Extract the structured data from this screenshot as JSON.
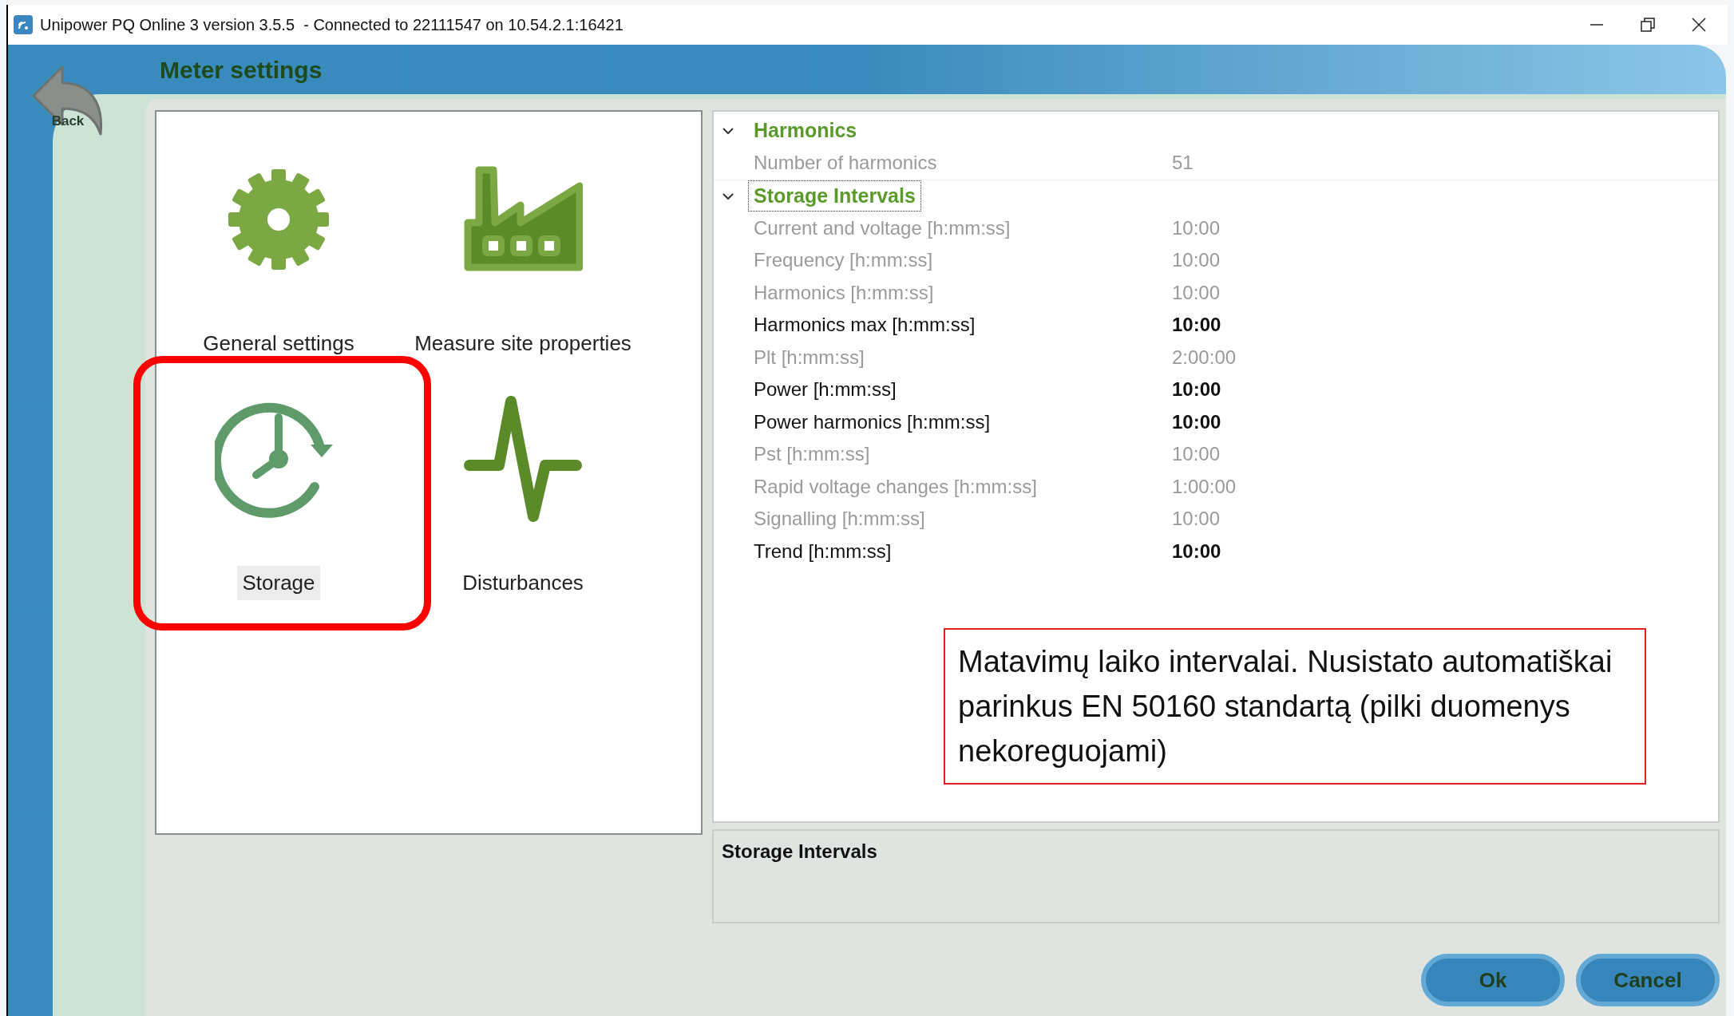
{
  "window": {
    "title": "Unipower PQ Online 3 version 3.5.5  - Connected to 22111547 on 10.54.2.1:16421"
  },
  "back_button": {
    "label": "Back"
  },
  "header": {
    "title": "Meter settings"
  },
  "categories": [
    {
      "label": "General settings",
      "kind": "gear",
      "selected": false,
      "highlighted": false
    },
    {
      "label": "Measure site properties",
      "kind": "factory",
      "selected": false,
      "highlighted": false
    },
    {
      "label": "Storage",
      "kind": "clock",
      "selected": true,
      "highlighted": true
    },
    {
      "label": "Disturbances",
      "kind": "pulse",
      "selected": false,
      "highlighted": false
    }
  ],
  "property_grid": {
    "groups": [
      {
        "title": "Harmonics",
        "expanded": true,
        "focused": false,
        "properties": [
          {
            "name": "Number of harmonics",
            "value": "51",
            "readonly": true
          }
        ]
      },
      {
        "title": "Storage Intervals",
        "expanded": true,
        "focused": true,
        "properties": [
          {
            "name": "Current and voltage [h:mm:ss]",
            "value": "10:00",
            "readonly": true
          },
          {
            "name": "Frequency [h:mm:ss]",
            "value": "10:00",
            "readonly": true
          },
          {
            "name": "Harmonics [h:mm:ss]",
            "value": "10:00",
            "readonly": true
          },
          {
            "name": "Harmonics max [h:mm:ss]",
            "value": "10:00",
            "readonly": false
          },
          {
            "name": "Plt [h:mm:ss]",
            "value": "2:00:00",
            "readonly": true
          },
          {
            "name": "Power [h:mm:ss]",
            "value": "10:00",
            "readonly": false
          },
          {
            "name": "Power harmonics [h:mm:ss]",
            "value": "10:00",
            "readonly": false
          },
          {
            "name": "Pst [h:mm:ss]",
            "value": "10:00",
            "readonly": true
          },
          {
            "name": "Rapid voltage changes [h:mm:ss]",
            "value": "1:00:00",
            "readonly": true
          },
          {
            "name": "Signalling [h:mm:ss]",
            "value": "10:00",
            "readonly": true
          },
          {
            "name": "Trend [h:mm:ss]",
            "value": "10:00",
            "readonly": false
          }
        ]
      }
    ]
  },
  "description": {
    "title": "Storage Intervals"
  },
  "annotation": {
    "text": "Matavimų laiko intervalai. Nusistato automatiškai parinkus EN 50160 standartą (pilki duomenys nekoreguojami)"
  },
  "buttons": [
    {
      "label": "Ok"
    },
    {
      "label": "Cancel"
    }
  ]
}
